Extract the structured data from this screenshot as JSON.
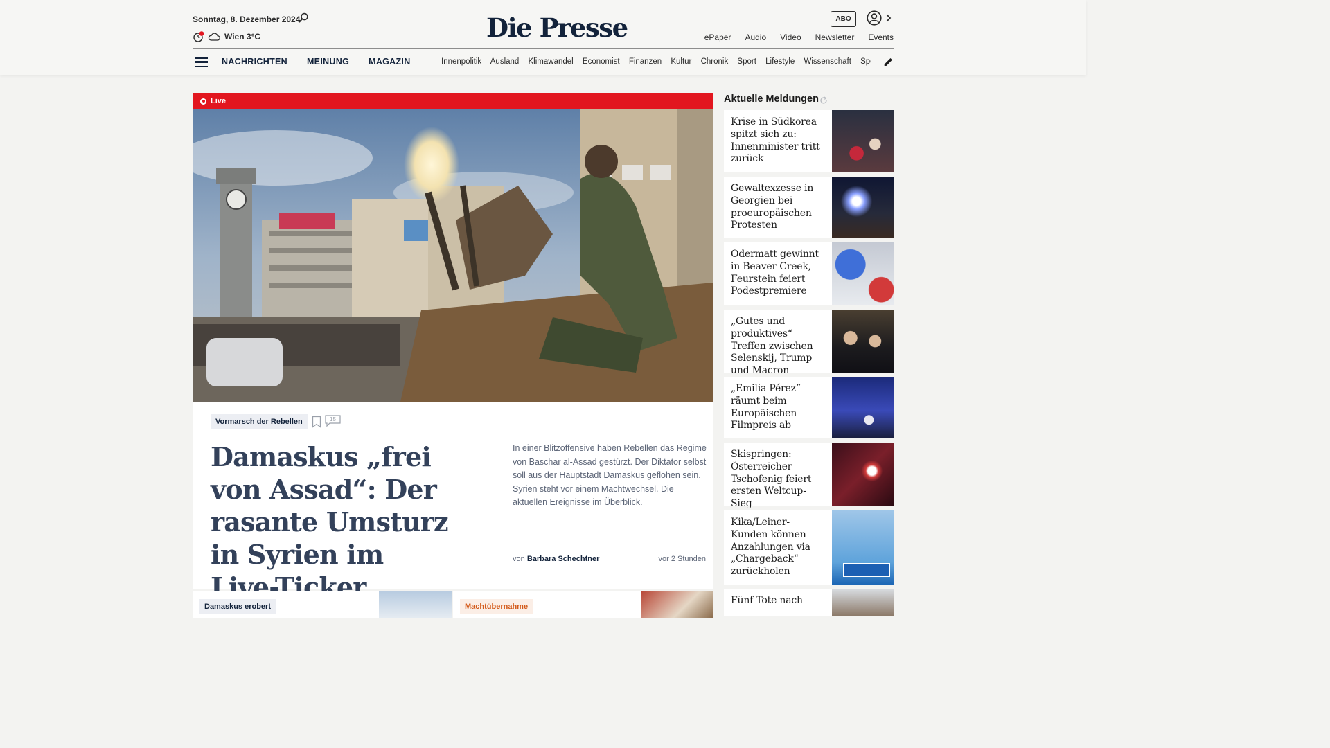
{
  "header": {
    "date": "Sonntag, 8. Dezember 2024",
    "weather": "Wien 3°C",
    "logo": "Die Presse",
    "abo_label": "ABO",
    "top_links": [
      "ePaper",
      "Audio",
      "Video",
      "Newsletter",
      "Events"
    ],
    "main_nav": [
      "NACHRICHTEN",
      "MEINUNG",
      "MAGAZIN"
    ],
    "sub_nav": [
      "Innenpolitik",
      "Ausland",
      "Klimawandel",
      "Economist",
      "Finanzen",
      "Kultur",
      "Chronik",
      "Sport",
      "Lifestyle",
      "Wissenschaft",
      "Spectrum"
    ]
  },
  "lead": {
    "live_label": "Live",
    "tag": "Vormarsch der Rebellen",
    "comment_count": "15",
    "headline": "Damaskus „frei von Assad“: Der rasante Umsturz in Syrien im Live-Ticker",
    "teaser": "In einer Blitzoffensive haben Rebellen das Regime von Baschar al-Assad gestürzt. Der Diktator selbst soll aus der Hauptstadt Damaskus geflohen sein. Syrien steht vor einem Machtwechsel. Die aktuellen Ereignisse im Überblick.",
    "byline_prefix": "von",
    "author": "Barbara Schechtner",
    "time": "vor 2 Stunden"
  },
  "bottom_cards": [
    {
      "tag": "Damaskus erobert"
    },
    {
      "tag": "Machtübernahme"
    }
  ],
  "sidebar": {
    "title": "Aktuelle Meldungen",
    "items": [
      {
        "title": "Krise in Südkorea spitzt sich zu: Innen­minister tritt zurück"
      },
      {
        "title": "Gewaltexzesse in Georgien bei proeu­ropäischen Protesten"
      },
      {
        "title": "Odermatt gewinnt in Beaver Creek, Feurstein feiert Podestpremiere"
      },
      {
        "title": "„Gutes und produktives“ Treffen zwischen Selenskij, Trump und Macron"
      },
      {
        "title": "„Emilia Pérez“ räumt beim Europäischen Filmpreis ab"
      },
      {
        "title": "Skispringen: Österreicher Tschofenig feiert ersten Weltcup-Sieg"
      },
      {
        "title": "Kika/Leiner-Kunden können Anzahlungen via „Chargeback“ zurückholen"
      },
      {
        "title": "Fünf Tote nach"
      }
    ]
  },
  "colors": {
    "brand_navy": "#13233b",
    "live_red": "#e2161f",
    "tag_orange": "#d35a1a",
    "background": "#f3f3f1"
  }
}
